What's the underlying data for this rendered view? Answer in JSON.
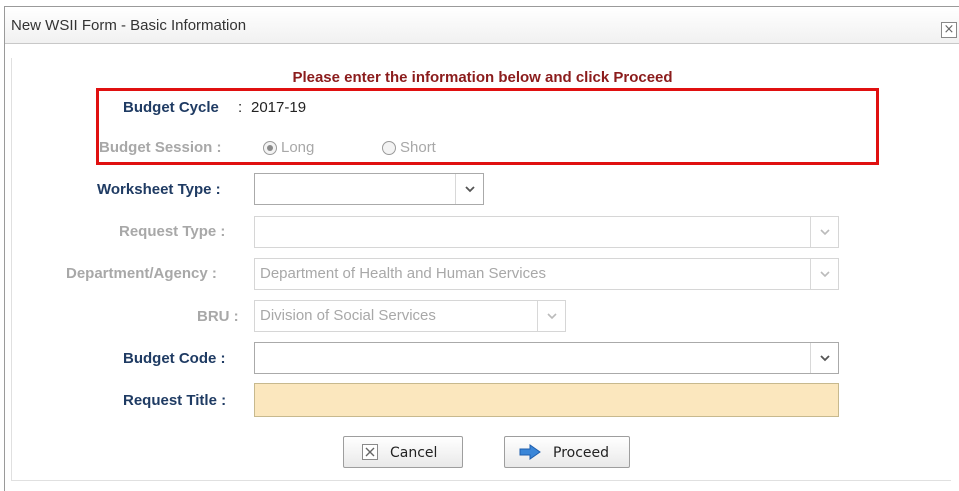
{
  "dialog": {
    "title": "New WSII Form - Basic Information",
    "close_glyph": "×"
  },
  "instruction": "Please enter the information below and click Proceed",
  "budget_cycle": {
    "label": "Budget Cycle",
    "colon": ":",
    "value": "2017-19"
  },
  "budget_session": {
    "label": "Budget Session :",
    "options": [
      {
        "label": "Long",
        "selected": true
      },
      {
        "label": "Short",
        "selected": false
      }
    ]
  },
  "worksheet_type": {
    "label": "Worksheet Type :",
    "value": ""
  },
  "request_type": {
    "label": "Request Type :",
    "value": ""
  },
  "department": {
    "label": "Department/Agency :",
    "value": "Department of Health and Human Services"
  },
  "bru": {
    "label": "BRU :",
    "value": "Division of Social Services"
  },
  "budget_code": {
    "label": "Budget Code :",
    "value": ""
  },
  "request_title": {
    "label": "Request Title :",
    "value": ""
  },
  "buttons": {
    "cancel": "Cancel",
    "proceed": "Proceed"
  },
  "colors": {
    "instruction": "#8b1c1c",
    "label_active": "#1f3b63",
    "label_disabled": "#a8a8a8",
    "highlight_border": "#e01010",
    "request_title_bg": "#fbe7be",
    "proceed_arrow": "#3a86d8"
  },
  "icons": {
    "close": "close-icon",
    "dropdown": "chevron-down-icon",
    "cancel": "x-box-icon",
    "proceed": "arrow-right-icon"
  }
}
